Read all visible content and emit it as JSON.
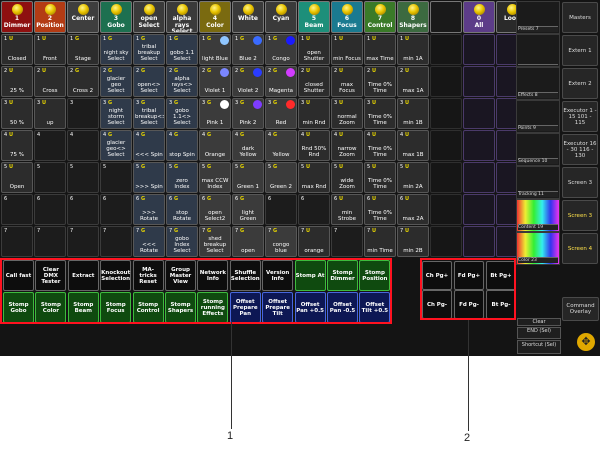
{
  "header": [
    {
      "num": "1",
      "name": "Dimmer",
      "color": "#8e1010"
    },
    {
      "num": "2",
      "name": "Position",
      "color": "#b33b14"
    },
    {
      "num": "",
      "name": "Center",
      "color": "#3e3e3e"
    },
    {
      "num": "3",
      "name": "Gobo",
      "color": "#1d7050"
    },
    {
      "num": "",
      "name": "open Select",
      "color": "#3a3a3a"
    },
    {
      "num": "",
      "name": "alpha rays Select",
      "color": "#3a3a3a"
    },
    {
      "num": "4",
      "name": "Color",
      "color": "#7a6a10"
    },
    {
      "num": "",
      "name": "White",
      "color": "#3a3a3a"
    },
    {
      "num": "",
      "name": "Cyan",
      "color": "#3a3a3a"
    },
    {
      "num": "5",
      "name": "Beam",
      "color": "#1d8f7a"
    },
    {
      "num": "6",
      "name": "Focus",
      "color": "#1a7a90"
    },
    {
      "num": "7",
      "name": "Control",
      "color": "#3a7a28"
    },
    {
      "num": "8",
      "name": "Shapers",
      "color": "#3c6a40"
    },
    {
      "num": "",
      "name": "",
      "color": "#1a1a1a"
    },
    {
      "num": "0",
      "name": "All",
      "color": "#5c3c88"
    },
    {
      "num": "",
      "name": "Look",
      "color": "#2a2a2a"
    }
  ],
  "grid": [
    [
      "Closed",
      "Front",
      "Stage",
      "night sky Select",
      "tribal breakup Select",
      "gobo 1.1 Select",
      "light Blue",
      "Blue 2",
      "Congo",
      "open Shutter",
      "min Focus",
      "max Time",
      "min 1A"
    ],
    [
      "25 %",
      "Cross",
      "Cross 2",
      "glacier geo Select",
      "open<> Select",
      "alpha rays<> Select",
      "Violet 1",
      "Violet 2",
      "Magenta",
      "closed Shutter",
      "max Focus",
      "Time 0% Time",
      "max 1A"
    ],
    [
      "50 %",
      "up",
      "",
      "night storm Select",
      "tribal breakup<> Select",
      "gobo 1.1<> Select",
      "Pink 1",
      "Pink 2",
      "Red",
      "min Rnd",
      "normal Zoom",
      "Time 0% Time",
      "min 1B"
    ],
    [
      "75 %",
      "",
      "",
      "glacier geo<> Select",
      "<<< Spin",
      "stop Spin",
      "Orange",
      "dark Yellow",
      "Yellow",
      "Rnd 50% Rnd",
      "narrow Zoom",
      "Time 0% Time",
      "max 1B"
    ],
    [
      "Open",
      "",
      "",
      "",
      ">>> Spin",
      "zero Index",
      "max CCW Index",
      "Green 1",
      "Green 2",
      "max Rnd",
      "wide Zoom",
      "Time 0% Time",
      "min 2A"
    ],
    [
      "",
      "",
      "",
      "",
      ">>> Rotate",
      "stop Rotate",
      "open Select2",
      "light Green",
      "",
      "",
      "min Strobe",
      "Time 0% Time",
      "max 2A"
    ],
    [
      "",
      "",
      "",
      "",
      "<<< Rotate",
      "gobo Index Select",
      "shed breakup Select",
      "open",
      "congo blue",
      "orange",
      "",
      "min Time",
      "min 2B"
    ]
  ],
  "swatches": {
    "6": [
      "#8fc6ff",
      "#7a86ff",
      "#ffffff"
    ],
    "7": [
      "#3a6bff",
      "#2a3cff",
      "#7e3cff"
    ],
    "8": [
      "#1a1aff",
      "#d23cff",
      "#ff2a2a"
    ]
  },
  "right_panel": [
    {
      "thumb": "Presets 7",
      "btn": "Masters",
      "active": false
    },
    {
      "thumb": "",
      "btn": "Extern 1",
      "active": false
    },
    {
      "thumb": "Effects 8",
      "btn": "Extern 2",
      "active": false
    },
    {
      "thumb": "Points 9",
      "btn": "Executor 1 - 15 101 - 115",
      "active": false
    },
    {
      "thumb": "Sequence 10",
      "btn": "Executor 16 - 30 116 - 130",
      "active": false
    },
    {
      "thumb": "Tracking 11",
      "btn": "Screen 3",
      "active": false
    },
    {
      "thumb": "Content 19",
      "btn": "Screen 3",
      "active": true
    },
    {
      "thumb": "Color 23",
      "btn": "Screen 4",
      "active": true
    }
  ],
  "commands_row1": [
    "Call fast",
    "Clear DMX Tester",
    "Extract",
    "Knockout Selection",
    "MA-tricks Reset",
    "Group Master View",
    "Network Info",
    "Shuffle Selection",
    "Version Info",
    "Stomp At",
    "Stomp Dimmer",
    "Stomp Position"
  ],
  "commands_row2": [
    "Stomp Gobo",
    "Stomp Color",
    "Stomp Beam",
    "Stomp Focus",
    "Stomp Control",
    "Stomp Shapers",
    "Stomp running Effects",
    "Offset Prepare Pan",
    "Offset Prepare Tilt",
    "Offset Pan +0.5",
    "Offset Pan -0.5",
    "Offset Tilt +0.5"
  ],
  "page_buttons": [
    "Ch Pg+",
    "Fd Pg+",
    "Bt Pg+",
    "Ch Pg-",
    "Fd Pg-",
    "Bt Pg-"
  ],
  "command_line": {
    "label": "Command Overlay",
    "clear": "Clear",
    "end": "END (Sel)",
    "shortcut": "Shortcut (Sel)"
  },
  "callouts": [
    "1",
    "2"
  ]
}
